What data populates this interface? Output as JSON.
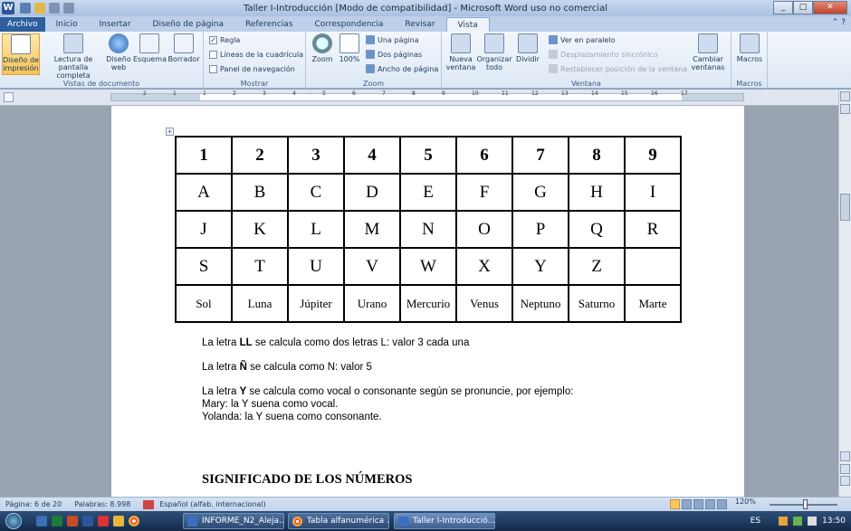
{
  "window": {
    "title": "Taller I-Introducción [Modo de compatibilidad] - Microsoft Word uso no comercial"
  },
  "tabs": [
    "Archivo",
    "Inicio",
    "Insertar",
    "Diseño de página",
    "Referencias",
    "Correspondencia",
    "Revisar",
    "Vista"
  ],
  "ribbon": {
    "vistas": {
      "label": "Vistas de documento",
      "print_layout": "Diseño de impresión",
      "full_screen": "Lectura de pantalla completa",
      "web": "Diseño web",
      "outline": "Esquema",
      "draft": "Borrador"
    },
    "mostrar": {
      "label": "Mostrar",
      "ruler": "Regla",
      "gridlines": "Líneas de la cuadrícula",
      "nav_pane": "Panel de navegación"
    },
    "zoom": {
      "label": "Zoom",
      "zoom": "Zoom",
      "hundred": "100%",
      "one_page": "Una página",
      "two_pages": "Dos páginas",
      "page_width": "Ancho de página"
    },
    "ventana": {
      "label": "Ventana",
      "new_window": "Nueva ventana",
      "arrange_all": "Organizar todo",
      "split": "Dividir",
      "side_by_side": "Ver en paralelo",
      "sync_scroll": "Desplazamiento sincrónico",
      "reset_pos": "Restablecer posición de la ventana",
      "switch": "Cambiar ventanas"
    },
    "macros": {
      "label": "Macros",
      "macros": "Macros"
    }
  },
  "ruler_ticks": [
    "2",
    "1",
    "1",
    "2",
    "3",
    "4",
    "5",
    "6",
    "7",
    "8",
    "9",
    "10",
    "11",
    "12",
    "13",
    "14",
    "15",
    "16",
    "17"
  ],
  "table": [
    [
      "1",
      "2",
      "3",
      "4",
      "5",
      "6",
      "7",
      "8",
      "9"
    ],
    [
      "A",
      "B",
      "C",
      "D",
      "E",
      "F",
      "G",
      "H",
      "I"
    ],
    [
      "J",
      "K",
      "L",
      "M",
      "N",
      "O",
      "P",
      "Q",
      "R"
    ],
    [
      "S",
      "T",
      "U",
      "V",
      "W",
      "X",
      "Y",
      "Z",
      ""
    ],
    [
      "Sol",
      "Luna",
      "Júpiter",
      "Urano",
      "Mercurio",
      "Venus",
      "Neptuno",
      "Saturno",
      "Marte"
    ]
  ],
  "doc": {
    "ll_pre": "La letra ",
    "ll_bold": "LL",
    "ll_post": " se calcula como dos letras L: valor 3 cada una",
    "n_pre": "La letra ",
    "n_bold": "Ñ",
    "n_post": " se calcula como N: valor 5",
    "y_pre": "La letra ",
    "y_bold": "Y",
    "y_post": " se calcula como vocal o consonante según se pronuncie, por ejemplo:",
    "mary": "Mary: la Y suena como vocal.",
    "yolanda": "Yolanda: la Y suena como consonante.",
    "heading": "SIGNIFICADO DE LOS NÚMEROS"
  },
  "status": {
    "page": "Página: 6 de 20",
    "words": "Palabras: 8.998",
    "language": "Español (alfab. internacional)",
    "zoom": "120%"
  },
  "taskbar": {
    "items": [
      "INFORME_N2_Aleja...",
      "Tabla alfanumérica ...",
      "Taller I-Introducció..."
    ],
    "lang": "ES",
    "time": "13:50"
  }
}
